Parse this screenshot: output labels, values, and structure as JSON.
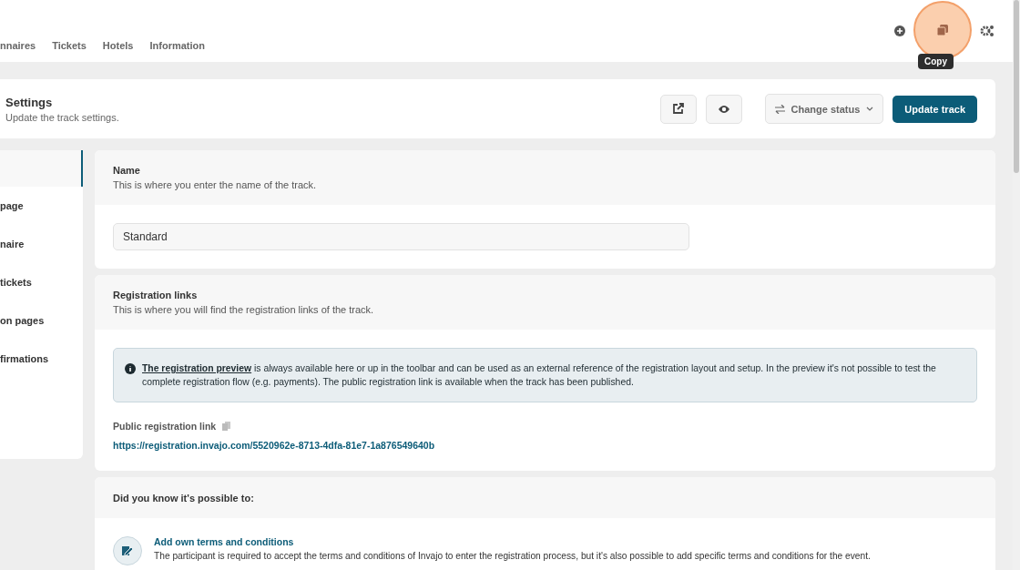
{
  "nav": {
    "tabs": [
      {
        "label": "nnaires",
        "selected": false
      },
      {
        "label": "Tickets",
        "selected": false
      },
      {
        "label": "Hotels",
        "selected": false
      },
      {
        "label": "Information",
        "selected": false
      }
    ],
    "tooltip": "Copy"
  },
  "header": {
    "title": "Settings",
    "subtitle": "Update the track settings.",
    "status_button": "Change status",
    "primary_button": "Update track"
  },
  "sidebar": {
    "items": [
      {
        "selected": true
      },
      {
        "label": "page",
        "selected": false
      },
      {
        "label": "naire",
        "selected": false
      },
      {
        "label": "tickets",
        "selected": false
      },
      {
        "label": "on pages",
        "selected": false
      },
      {
        "label": "firmations",
        "selected": false
      }
    ]
  },
  "name_section": {
    "title": "Name",
    "description": "This is where you enter the name of the track.",
    "value": "Standard"
  },
  "links_section": {
    "title": "Registration links",
    "description": "This is where you will find the registration links of the track.",
    "notice_link": "The registration preview",
    "notice_text": " is always available here or up in the toolbar and can be used as an external reference of the registration layout and setup. In the preview it's not possible to test the complete registration flow (e.g. payments). The public registration link is available when the track has been published.",
    "public_label": "Public registration link",
    "public_url": "https://registration.invajo.com/5520962e-8713-4dfa-81e7-1a876549640b"
  },
  "tips_section": {
    "title": "Did you know it's possible to:",
    "items": [
      {
        "title": "Add own terms and conditions",
        "text": "The participant is required to accept the terms and conditions of Invajo to enter the registration process, but it's also possible to add specific terms and conditions for the event."
      }
    ]
  }
}
